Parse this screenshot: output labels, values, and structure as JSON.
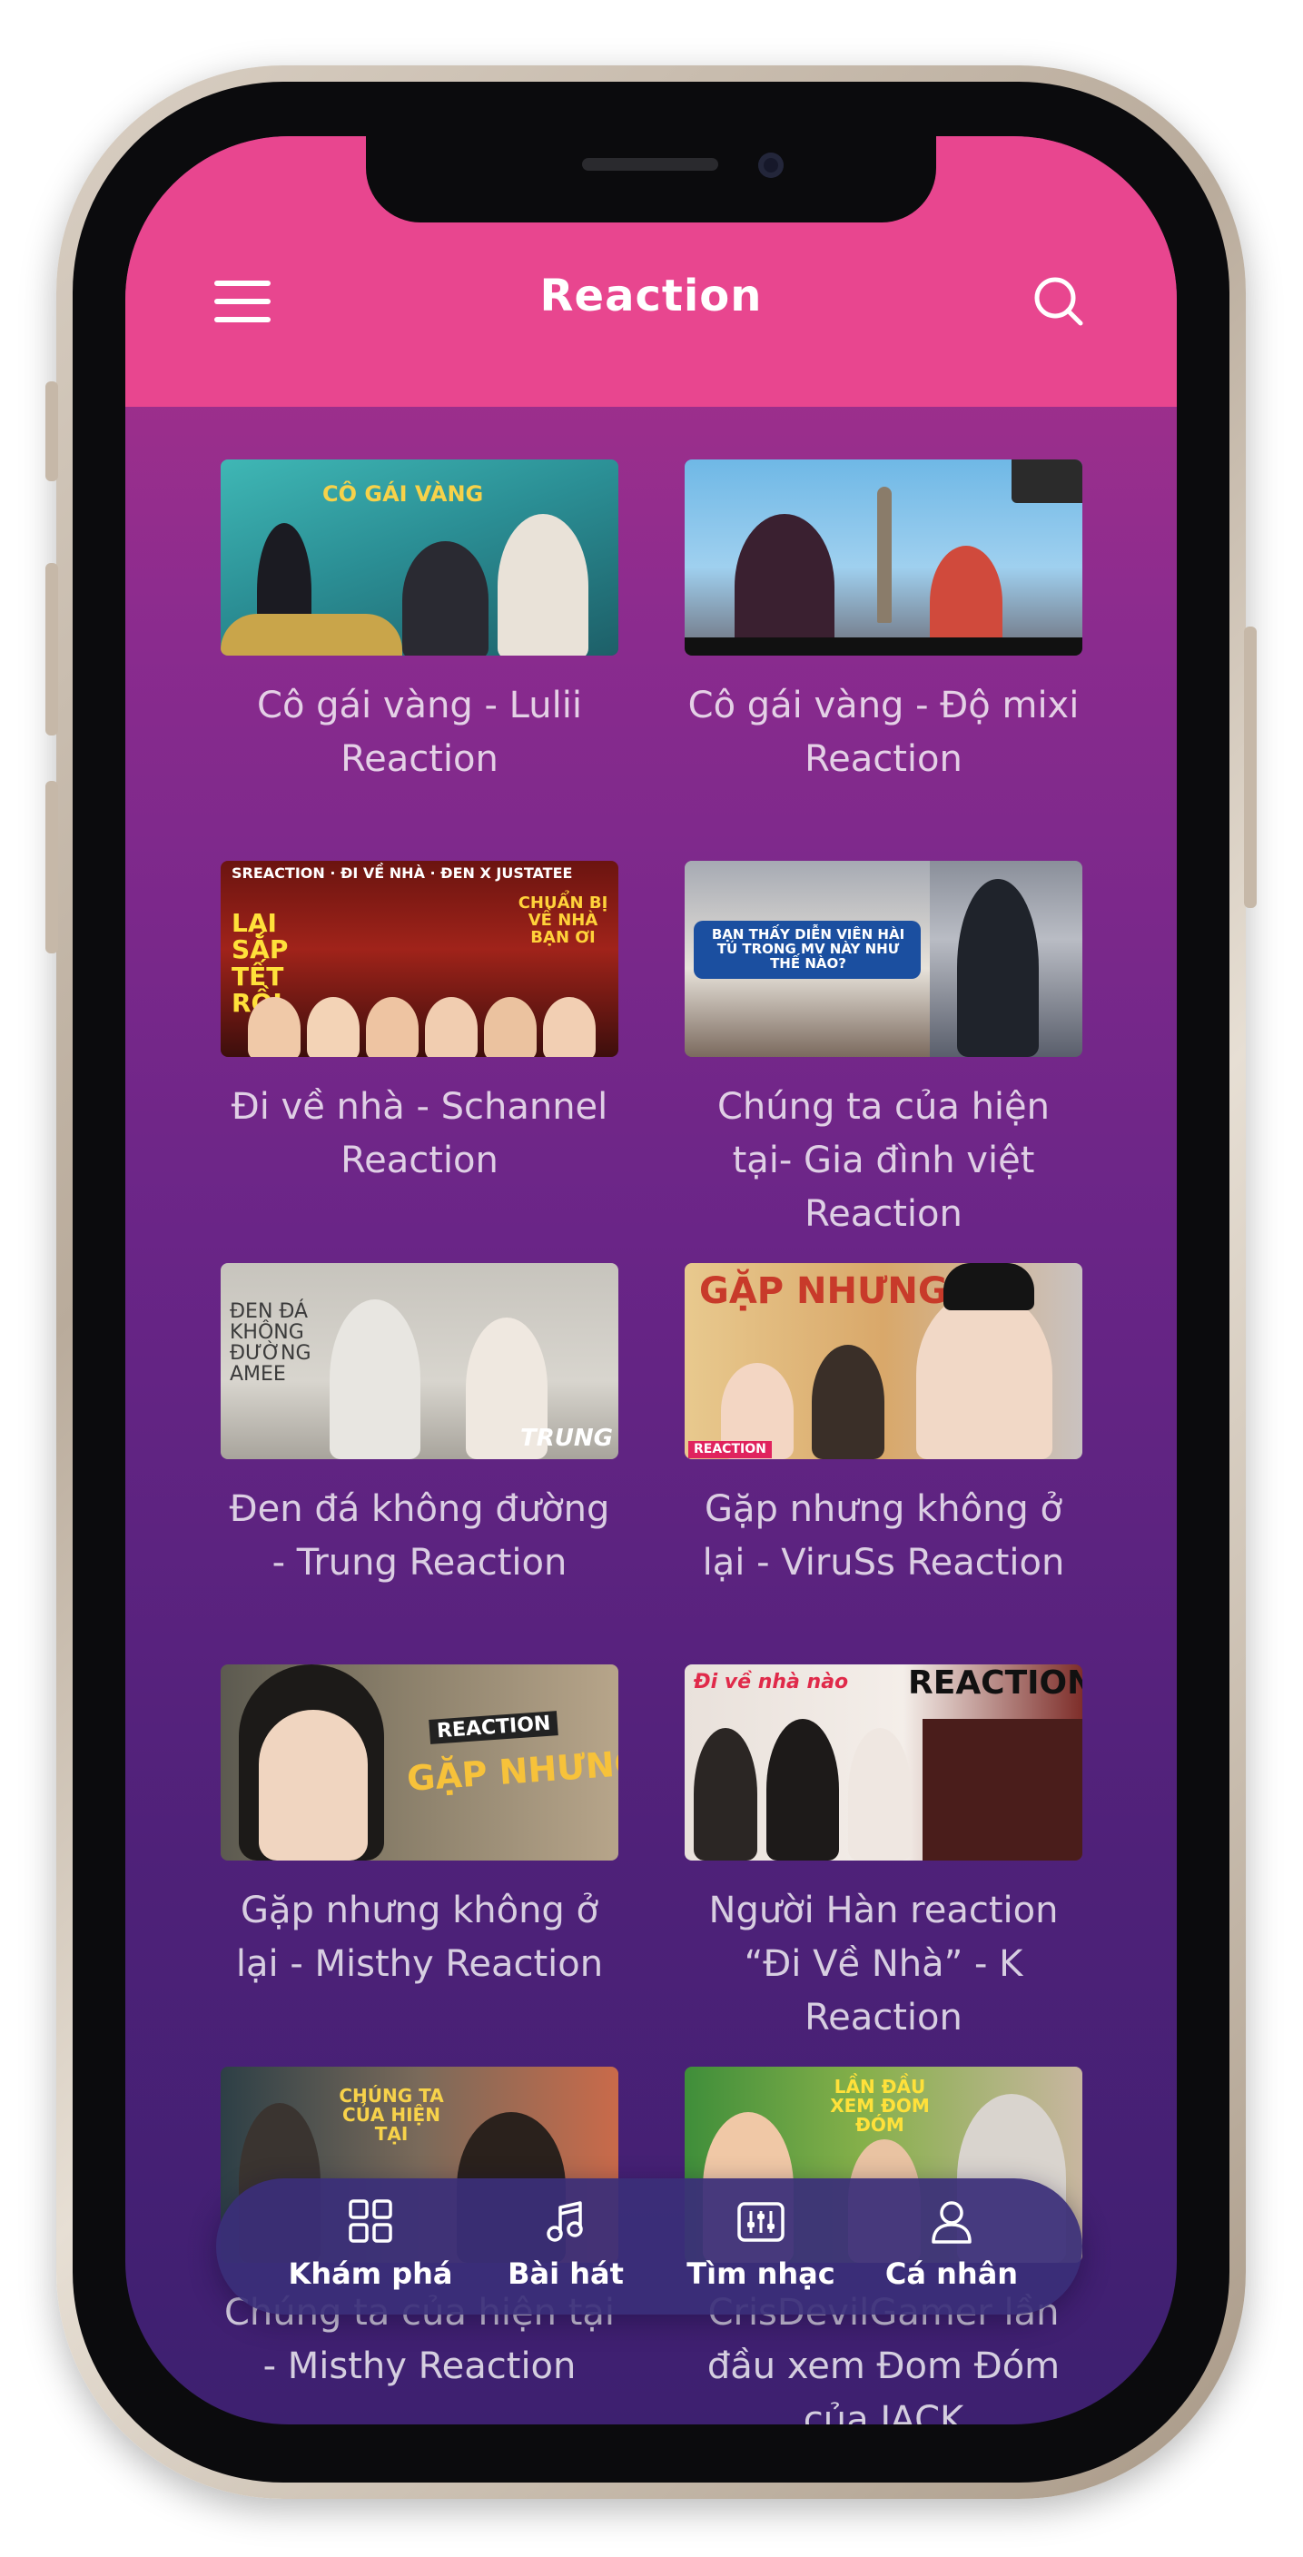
{
  "header": {
    "title": "Reaction",
    "menu_icon": "hamburger-menu-icon",
    "search_icon": "search-icon",
    "background": "#e8468f"
  },
  "videos": [
    {
      "title": "Cô gái vàng - Lulii Reaction",
      "thumb_caption": "CÔ GÁI VÀNG"
    },
    {
      "title": "Cô gái vàng - Độ mixi Reaction",
      "thumb_caption": ""
    },
    {
      "title": "Đi về nhà - Schannel Reaction",
      "thumb_caption": "LẠI SẮP TẾT RỒI",
      "thumb_caption_2": "CHUẨN BỊ VỀ NHÀ BẠN ƠI",
      "thumb_header": "SREACTION · ĐI VỀ NHÀ · ĐEN X JUSTATEE"
    },
    {
      "title": "Chúng ta của hiện tại- Gia đình việt Reaction",
      "thumb_caption": "BẠN THẤY DIỄN VIÊN HÀI TÚ TRONG MV NÀY NHƯ THẾ NÀO?"
    },
    {
      "title": "Đen đá không đường - Trung Reaction",
      "thumb_caption": "ĐEN ĐÁ KHÔNG ĐƯỜNG AMEE",
      "thumb_caption_2": "TRUNG"
    },
    {
      "title": "Gặp nhưng không ở lại - ViruSs Reaction",
      "thumb_caption": "GẶP NHƯNG",
      "thumb_caption_2": "REACTION"
    },
    {
      "title": "Gặp nhưng không ở lại - Misthy Reaction",
      "thumb_caption": "GẶP NHƯNG",
      "thumb_caption_2": "REACTION"
    },
    {
      "title": "Người Hàn reaction “Đi Về Nhà” - K Reaction",
      "thumb_caption": "REACTION",
      "thumb_caption_2": "Đi về nhà nào"
    },
    {
      "title": "Chúng ta của hiện tại - Misthy Reaction",
      "thumb_caption": "CHÚNG TA CỦA HIỆN TẠI"
    },
    {
      "title": "CrisDevilGamer lần đầu xem Đom Đóm của JACK",
      "thumb_caption": "LẦN ĐẦU XEM ĐOM ĐÓM"
    }
  ],
  "tabbar": {
    "items": [
      {
        "label": "Khám phá",
        "icon": "grid-icon"
      },
      {
        "label": "Bài hát",
        "icon": "music-note-icon"
      },
      {
        "label": "Tìm nhạc",
        "icon": "equalizer-icon"
      },
      {
        "label": "Cá nhân",
        "icon": "user-icon"
      }
    ]
  }
}
